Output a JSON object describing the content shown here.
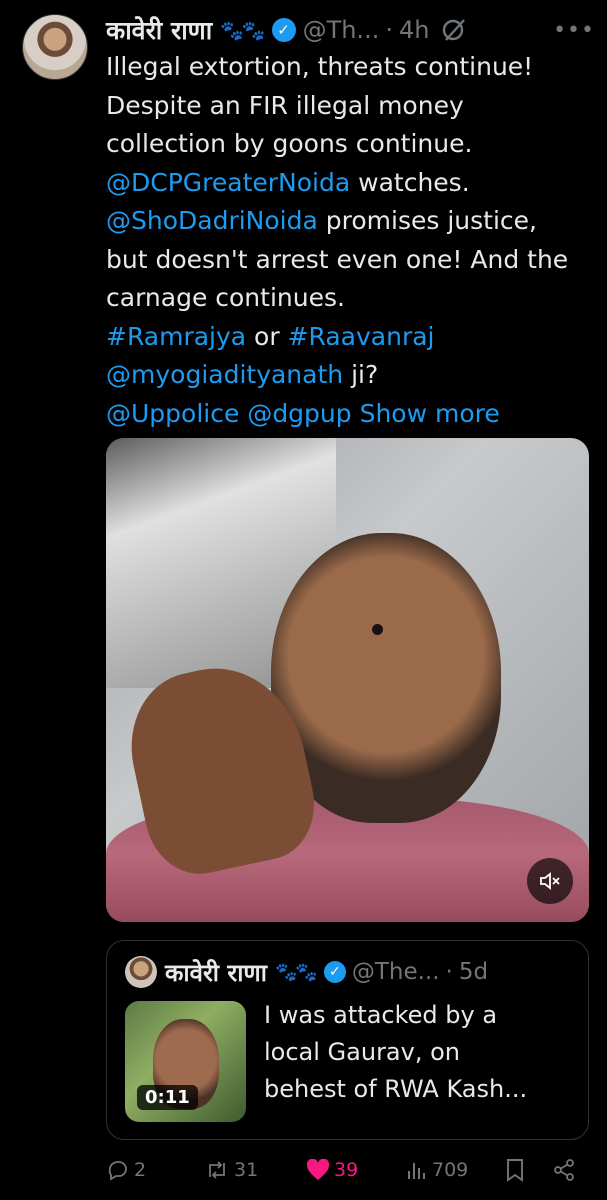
{
  "tweet": {
    "author_name": "कावेरी राणा",
    "author_emoji": "🐾🐾",
    "handle": "@Th...",
    "separator": "·",
    "time": "4h",
    "text_lines": [
      [
        {
          "t": "Illegal extortion, threats continue!",
          "link": false
        }
      ],
      [
        {
          "t": "Despite an FIR illegal money",
          "link": false
        }
      ],
      [
        {
          "t": "collection by goons continue.",
          "link": false
        }
      ],
      [
        {
          "t": "@DCPGreaterNoida",
          "link": true
        },
        {
          "t": " watches.",
          "link": false
        }
      ],
      [
        {
          "t": "@ShoDadriNoida",
          "link": true
        },
        {
          "t": " promises justice,",
          "link": false
        }
      ],
      [
        {
          "t": "but doesn't arrest even one! And the",
          "link": false
        }
      ],
      [
        {
          "t": "carnage continues.",
          "link": false
        }
      ],
      [
        {
          "t": "#Ramrajya",
          "link": true
        },
        {
          "t": " or ",
          "link": false
        },
        {
          "t": "#Raavanraj",
          "link": true
        }
      ],
      [
        {
          "t": "@myogiadityanath",
          "link": true
        },
        {
          "t": " ji?",
          "link": false
        }
      ],
      [
        {
          "t": "@Uppolice",
          "link": true
        },
        {
          "t": " ",
          "link": false
        },
        {
          "t": "@dgpup",
          "link": true
        },
        {
          "t": " Show more",
          "link": true
        }
      ]
    ]
  },
  "quote": {
    "author_name": "कावेरी राणा",
    "author_emoji": "🐾🐾",
    "handle": "@The...",
    "separator": "·",
    "time": "5d",
    "video_duration": "0:11",
    "text_lines": [
      "I was attacked by a",
      "local Gaurav, on",
      "behest of RWA Kash..."
    ]
  },
  "actions": {
    "replies": "2",
    "reposts": "31",
    "likes": "39",
    "views": "709"
  },
  "colors": {
    "accent": "#1d9bf0",
    "like": "#f91880",
    "muted": "#71767b",
    "background": "#000000"
  },
  "icons": [
    "more-icon",
    "grok-icon",
    "verified-badge-icon",
    "mute-icon",
    "reply-icon",
    "repost-icon",
    "like-icon",
    "views-icon",
    "bookmark-icon",
    "share-icon"
  ]
}
